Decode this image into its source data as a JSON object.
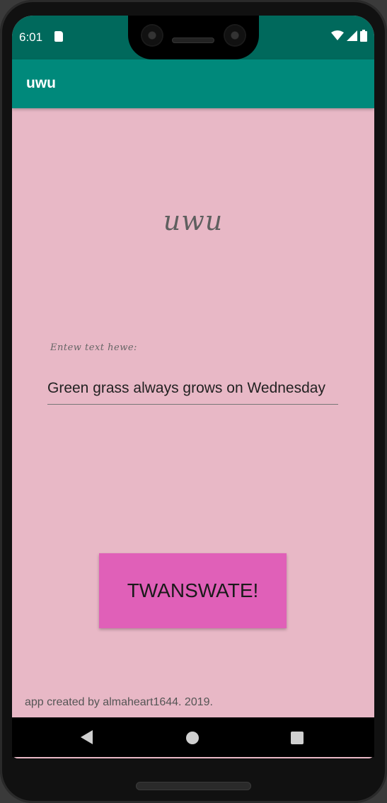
{
  "status_bar": {
    "time": "6:01",
    "sd_icon": "sd-card-icon",
    "wifi_icon": "wifi-icon",
    "signal_icon": "cell-signal-icon",
    "battery_icon": "battery-icon"
  },
  "app_bar": {
    "title": "uwu"
  },
  "main": {
    "headline": "uwu",
    "input_label": "Entew text hewe:",
    "input_value": "Green grass always grows on Wednesday",
    "button_label": "TWANSWATE!",
    "credit": "app created by almaheart1644. 2019."
  },
  "nav_bar": {
    "back_icon": "back-triangle-icon",
    "home_icon": "home-circle-icon",
    "recents_icon": "recents-square-icon"
  },
  "colors": {
    "status_bar": "#00695c",
    "app_bar": "#00897b",
    "background": "#e8b8c6",
    "button": "#e060b8"
  }
}
